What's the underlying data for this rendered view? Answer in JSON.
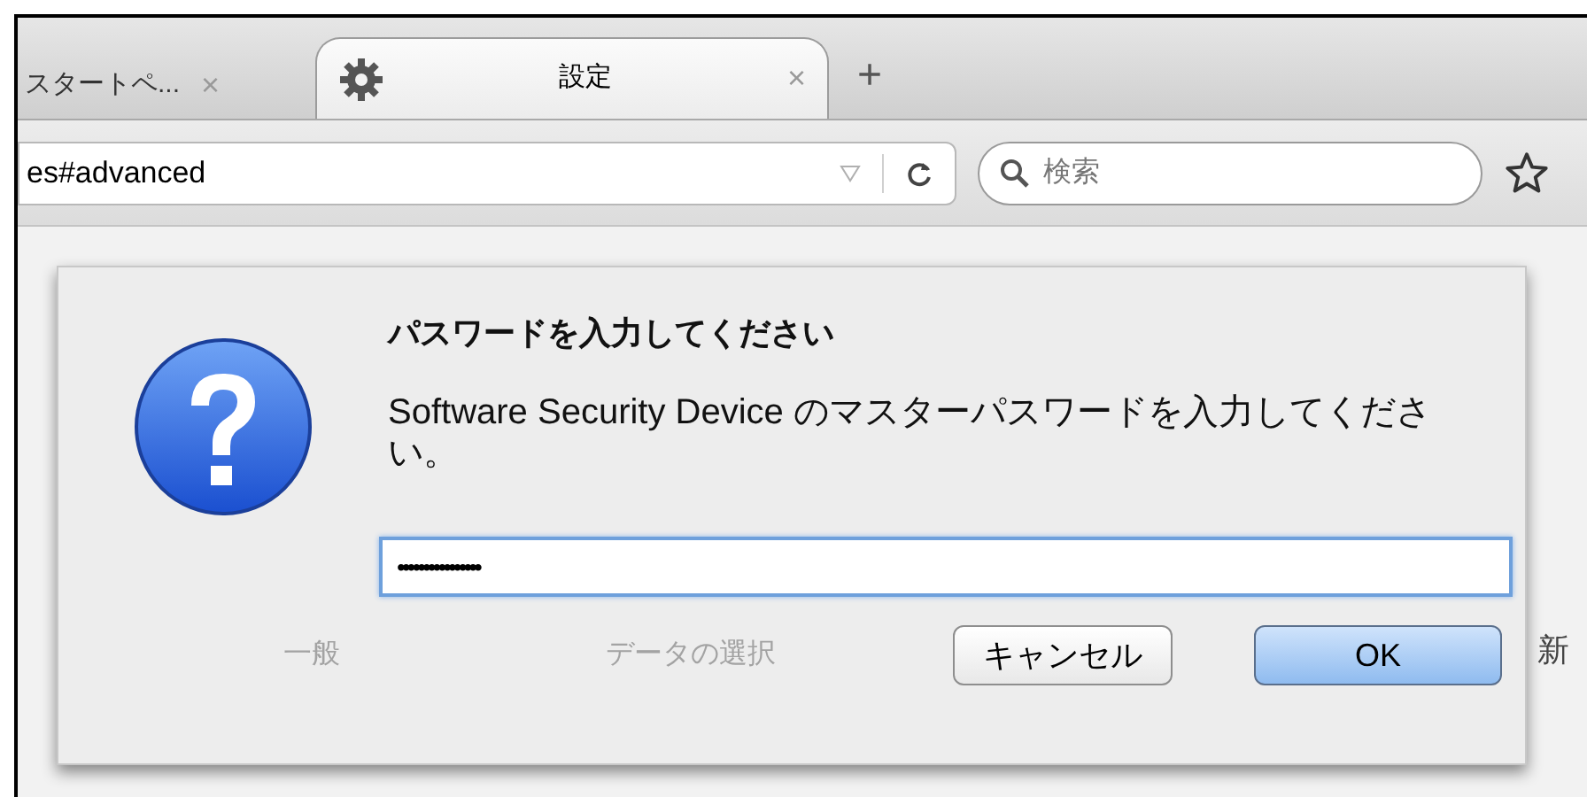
{
  "tabs": [
    {
      "label": "スタートペ...",
      "selected": false,
      "close": "×"
    },
    {
      "label": "設定",
      "selected": true,
      "close": "×"
    }
  ],
  "new_tab": "+",
  "address_bar": {
    "value": "es#advanced"
  },
  "search": {
    "placeholder": "検索"
  },
  "background_tabs": [
    "一般",
    "データの選択",
    "新"
  ],
  "dialog": {
    "title": "パスワードを入力してください",
    "message": "Software Security Device のマスターパスワードを入力してください。",
    "password": {
      "value": "••••••••••••••••",
      "focused": true
    },
    "buttons": [
      {
        "label": "キャンセル",
        "default": false
      },
      {
        "label": "OK",
        "default": true
      }
    ]
  }
}
